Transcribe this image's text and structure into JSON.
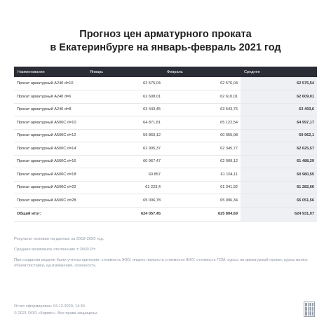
{
  "title": {
    "line1": "Прогноз цен арматурного проката",
    "line2": "в Екатеринбурге на январь-февраль 2021 год"
  },
  "table": {
    "headers": [
      "Наименование",
      "Январь",
      "Февраль",
      "Среднее"
    ],
    "rows": [
      {
        "name": "Прокат арматурный А240 d=10",
        "jan": "62 575,04",
        "feb": "62 576,04",
        "avg": "62 575,54"
      },
      {
        "name": "Прокат арматурный А240 d=6",
        "jan": "62 608,01",
        "feb": "62 610,01",
        "avg": "62 609,01"
      },
      {
        "name": "Прокат арматурный А240 d=8",
        "jan": "63 443,45",
        "feb": "63 543,76",
        "avg": "63 493,6"
      },
      {
        "name": "Прокат арматурный А500С d=10",
        "jan": "64 871,81",
        "feb": "65 122,54",
        "avg": "64 997,17"
      },
      {
        "name": "Прокат арматурный А500С d=12",
        "jan": "59 869,12",
        "feb": "60 055,08",
        "avg": "59 962,1"
      },
      {
        "name": "Прокат арматурный А500С d=14",
        "jan": "62 905,37",
        "feb": "62 345,77",
        "avg": "62 625,57"
      },
      {
        "name": "Прокат арматурный А500С d=16",
        "jan": "60 967,47",
        "feb": "62 009,12",
        "avg": "61 488,29"
      },
      {
        "name": "Прокат арматурный А500С d=18",
        "jan": "60 857",
        "feb": "61 104,11",
        "avg": "60 980,55"
      },
      {
        "name": "Прокат арматурный А500С d=22",
        "jan": "61 223,4",
        "feb": "61 341,92",
        "avg": "61 282,66"
      },
      {
        "name": "Прокат арматурный А500С d=28",
        "jan": "65 006,78",
        "feb": "65 096,34",
        "avg": "65 051,56"
      }
    ],
    "total": {
      "label": "Общий итог:",
      "jan": "624 057,45",
      "feb": "625 804,69",
      "avg": "624 931,07"
    }
  },
  "notes": [
    "Результат основан на данных за 2018-2020 год.",
    "Среднее возможное отклонение ± 2000 Р/т",
    "При создании модели были учтены критерии: стоимость ЖКУ, индекс прироста стоимости ЖКУ, стоимость ГСМ, курсы на арматурный прокат, курсы валют, объём поставки, ед.измерения, сезонность"
  ],
  "footer": {
    "generated": "Отчет сформирован: 04.12.2020, 14:34",
    "copyright": "© 2021 ООО «Кирпич». Все права защищены."
  }
}
